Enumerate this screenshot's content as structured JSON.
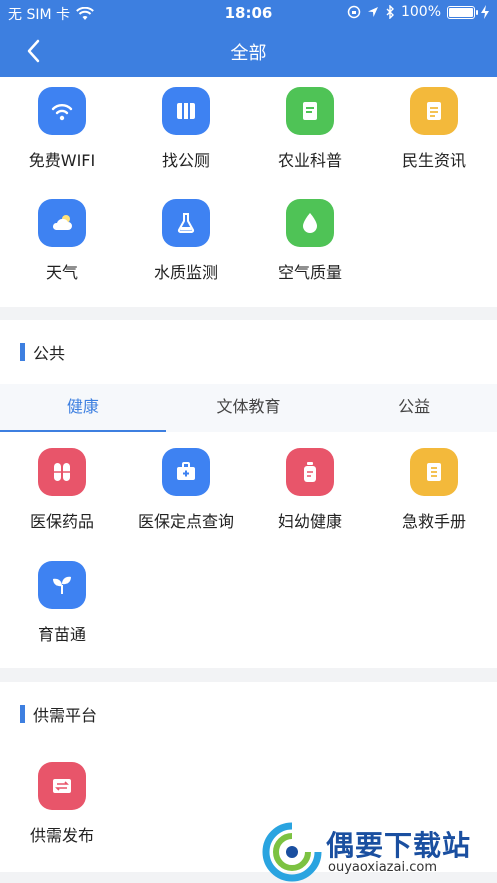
{
  "status_bar": {
    "carrier": "无 SIM 卡",
    "time": "18:06",
    "battery": "100%",
    "battery_level": 1.0
  },
  "nav": {
    "title": "全部",
    "back_icon": "chevron-left-icon"
  },
  "top_grid": [
    {
      "label": "免费WIFI",
      "icon": "wifi-icon",
      "color": "#3e82f2"
    },
    {
      "label": "找公厕",
      "icon": "map-icon",
      "color": "#3e82f2"
    },
    {
      "label": "农业科普",
      "icon": "document-icon",
      "color": "#4fc356"
    },
    {
      "label": "民生资讯",
      "icon": "news-icon",
      "color": "#f3b93b"
    },
    {
      "label": "天气",
      "icon": "cloud-icon",
      "color": "#3e82f2"
    },
    {
      "label": "水质监测",
      "icon": "flask-icon",
      "color": "#3e82f2"
    },
    {
      "label": "空气质量",
      "icon": "drop-icon",
      "color": "#4fc356"
    }
  ],
  "public_section": {
    "title": "公共",
    "tabs": [
      {
        "label": "健康",
        "active": true
      },
      {
        "label": "文体教育",
        "active": false
      },
      {
        "label": "公益",
        "active": false
      }
    ],
    "items": [
      {
        "label": "医保药品",
        "icon": "pill-icon",
        "color": "#e8556a"
      },
      {
        "label": "医保定点查询",
        "icon": "medkit-icon",
        "color": "#3e82f2"
      },
      {
        "label": "妇幼健康",
        "icon": "bottle-icon",
        "color": "#e8556a"
      },
      {
        "label": "急救手册",
        "icon": "handbook-icon",
        "color": "#f3b93b"
      },
      {
        "label": "育苗通",
        "icon": "sprout-icon",
        "color": "#3e82f2"
      }
    ]
  },
  "supply_section": {
    "title": "供需平台",
    "items": [
      {
        "label": "供需发布",
        "icon": "exchange-icon",
        "color": "#e8556a"
      }
    ]
  },
  "watermark": {
    "title": "偶要下载站",
    "url": "ouyaoxiazai.com"
  }
}
